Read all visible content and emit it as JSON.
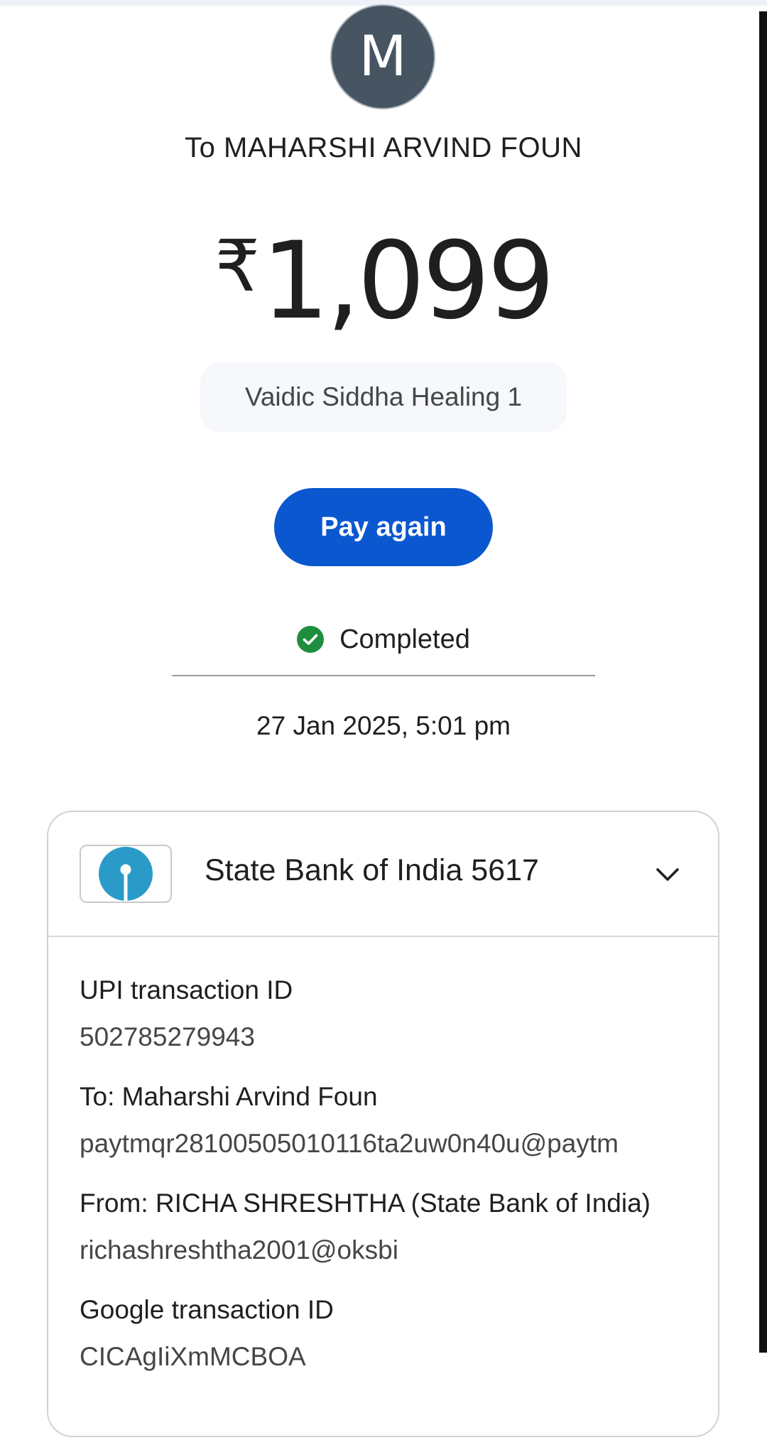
{
  "header": {
    "avatar_initial": "M",
    "title": "To MAHARSHI ARVIND FOUN"
  },
  "payment": {
    "currency_symbol": "₹",
    "amount": "1,099",
    "note": "Vaidic Siddha Healing 1",
    "pay_again_label": "Pay again",
    "status": "Completed",
    "status_color": "#1e8e3e",
    "datetime": "27 Jan 2025, 5:01 pm"
  },
  "account": {
    "bank_name": "State Bank of India 5617",
    "logo_icon": "sbi-logo-icon",
    "logo_color": "#2a9bc8",
    "expand_icon": "chevron-down-icon"
  },
  "details": [
    {
      "label": "UPI transaction ID",
      "value": "502785279943"
    },
    {
      "label": "To: Maharshi Arvind Foun",
      "value": "paytmqr28100505010116ta2uw0n40u@paytm"
    },
    {
      "label": "From: RICHA  SHRESHTHA (State Bank of India)",
      "value": "richashreshtha2001@oksbi"
    },
    {
      "label": "Google transaction ID",
      "value": "CICAgIiXmMCBOA"
    }
  ],
  "colors": {
    "accent": "#0b57d0",
    "avatar_bg": "#465561"
  }
}
